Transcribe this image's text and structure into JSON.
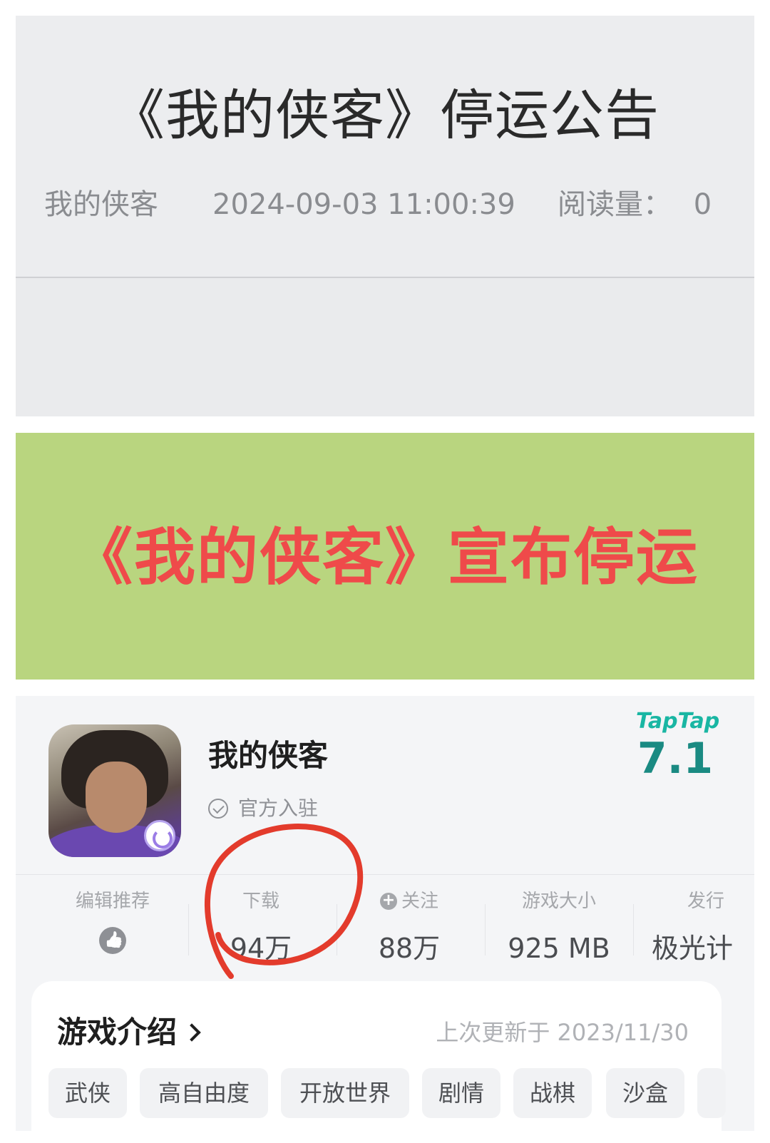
{
  "notice": {
    "title": "《我的侠客》停运公告",
    "author": "我的侠客",
    "datetime": "2024-09-03 11:00:39",
    "reads_label": "阅读量：",
    "reads_value": "0"
  },
  "banner": {
    "text": "《我的侠客》宣布停运"
  },
  "app": {
    "name": "我的侠客",
    "official_label": "官方入驻",
    "rating_brand": "TapTap",
    "rating": "7.1",
    "stats": [
      {
        "label": "编辑推荐",
        "value": "",
        "icon": "thumbs-up-icon"
      },
      {
        "label": "下载",
        "value": "94万"
      },
      {
        "label": "关注",
        "value": "88万",
        "icon": "plus-circle-icon"
      },
      {
        "label": "游戏大小",
        "value": "925 MB"
      },
      {
        "label": "发行",
        "value": "极光计"
      }
    ],
    "intro_title": "游戏介绍",
    "last_update": "上次更新于 2023/11/30",
    "tags": [
      "武侠",
      "高自由度",
      "开放世界",
      "剧情",
      "战棋",
      "沙盒"
    ]
  },
  "colors": {
    "banner_bg": "#b9d57f",
    "banner_text": "#ef4a4a",
    "taptap_green": "#19b6a3",
    "annotation_red": "#e33b2c"
  }
}
